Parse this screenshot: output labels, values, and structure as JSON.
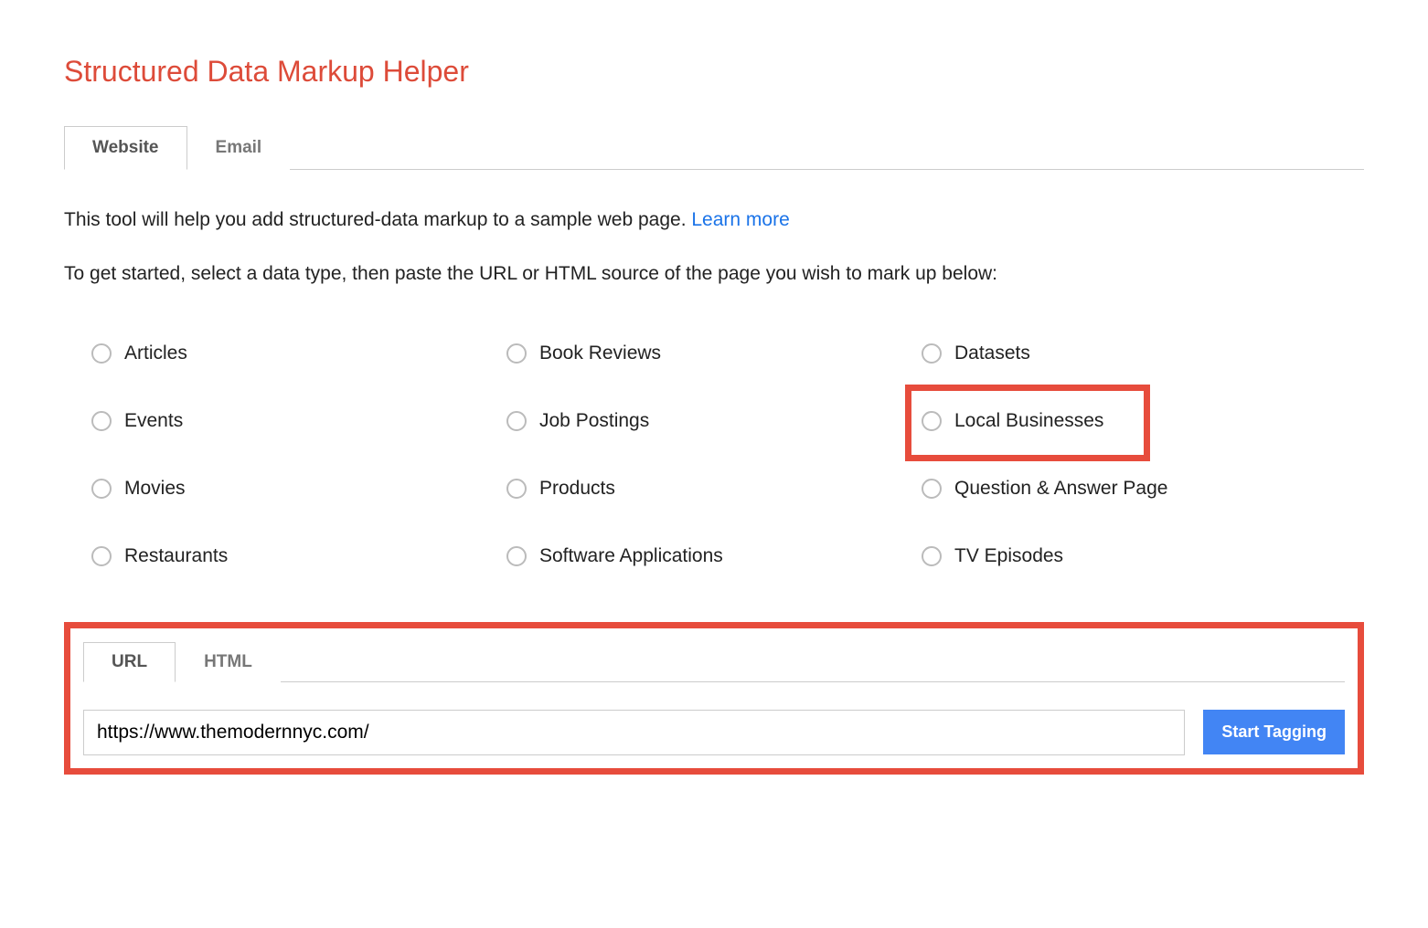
{
  "header": {
    "title": "Structured Data Markup Helper"
  },
  "tabs": {
    "website": "Website",
    "email": "Email"
  },
  "intro": {
    "text": "This tool will help you add structured-data markup to a sample web page. ",
    "learn_more": "Learn more"
  },
  "getstarted": "To get started, select a data type, then paste the URL or HTML source of the page you wish to mark up below:",
  "datatypes": {
    "articles": "Articles",
    "book_reviews": "Book Reviews",
    "datasets": "Datasets",
    "events": "Events",
    "job_postings": "Job Postings",
    "local_businesses": "Local Businesses",
    "movies": "Movies",
    "products": "Products",
    "qa_page": "Question & Answer Page",
    "restaurants": "Restaurants",
    "software_apps": "Software Applications",
    "tv_episodes": "TV Episodes"
  },
  "input_section": {
    "tab_url": "URL",
    "tab_html": "HTML",
    "url_value": "https://www.themodernnyc.com/",
    "start_label": "Start Tagging"
  }
}
